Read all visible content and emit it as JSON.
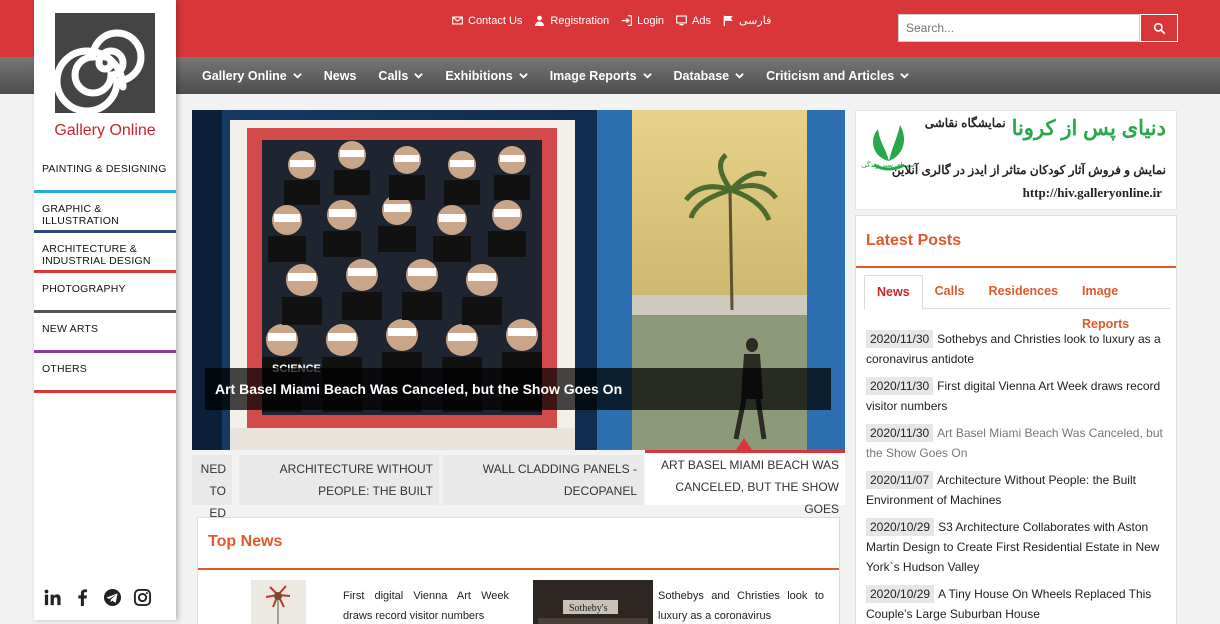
{
  "header": {
    "links": [
      {
        "label": "Contact Us",
        "icon": "envelope-icon"
      },
      {
        "label": "Registration",
        "icon": "user-icon"
      },
      {
        "label": "Login",
        "icon": "sign-in-icon"
      },
      {
        "label": "Ads",
        "icon": "monitor-icon"
      },
      {
        "label": "فارسی",
        "icon": "flag-icon"
      }
    ],
    "search_placeholder": "Search..."
  },
  "nav": {
    "items": [
      {
        "label": "Gallery Online",
        "dropdown": true
      },
      {
        "label": "News",
        "dropdown": false
      },
      {
        "label": "Calls",
        "dropdown": true
      },
      {
        "label": "Exhibitions",
        "dropdown": true
      },
      {
        "label": "Image Reports",
        "dropdown": true
      },
      {
        "label": "Database",
        "dropdown": true
      },
      {
        "label": "Criticism and Articles",
        "dropdown": true
      }
    ]
  },
  "sidebar": {
    "logo_text": "Gallery Online",
    "categories": [
      {
        "label": "PAINTING & DESIGNING",
        "color": "#2aa8d8"
      },
      {
        "label": "GRAPHIC & ILLUSTRATION",
        "color": "#2d4a7a"
      },
      {
        "label": "ARCHITECTURE & INDUSTRIAL DESIGN",
        "color": "#d9363a"
      },
      {
        "label": "PHOTOGRAPHY",
        "color": "#555555"
      },
      {
        "label": "NEW ARTS",
        "color": "#8a3a9a"
      },
      {
        "label": "OTHERS",
        "color": "#d9363a"
      }
    ],
    "socials": [
      "linkedin-icon",
      "facebook-icon",
      "telegram-icon",
      "instagram-icon"
    ]
  },
  "slider": {
    "caption": "Art Basel Miami Beach Was Canceled, but the Show Goes On",
    "thumbs": [
      {
        "line1": "NED TO",
        "line2": "ED FOR"
      },
      {
        "line1": "ARCHITECTURE WITHOUT",
        "line2": "PEOPLE: THE BUILT"
      },
      {
        "line1": "WALL CLADDING PANELS -",
        "line2": "DECOPANEL"
      },
      {
        "line1": "ART BASEL MIAMI BEACH WAS",
        "line2": "CANCELED, BUT THE SHOW GOES"
      }
    ],
    "poster_label": "SCIENCE"
  },
  "top_news": {
    "title": "Top News",
    "items": [
      {
        "text": "First digital Vienna Art Week draws record visitor numbers"
      },
      {
        "text": "Sothebys and Christies look to luxury as a coronavirus"
      }
    ],
    "store_sign": "Sotheby's"
  },
  "ad": {
    "title": "دنیای پس از کرونا",
    "subtitle": "نمایشگاه نقاشی",
    "desc": "نمایش و فروش آثار کودکان متاثر از ایدز در گالری آنلاین",
    "url": "http://hiv.galleryonline.ir",
    "logo_caption": "سیمای سبز زندگی"
  },
  "latest": {
    "title": "Latest Posts",
    "tabs": [
      "News",
      "Calls",
      "Residences",
      "Image Reports"
    ],
    "posts": [
      {
        "date": "2020/11/30",
        "text": "Sothebys and Christies look to luxury as a coronavirus antidote",
        "muted": false
      },
      {
        "date": "2020/11/30",
        "text": "First digital Vienna Art Week draws record visitor numbers",
        "muted": false
      },
      {
        "date": "2020/11/30",
        "text": "Art Basel Miami Beach Was Canceled, but the Show Goes On",
        "muted": true
      },
      {
        "date": "2020/11/07",
        "text": "Architecture Without People: the Built Environment of Machines",
        "muted": false
      },
      {
        "date": "2020/10/29",
        "text": "S3 Architecture Collaborates with Aston Martin Design to Create First Residential Estate in New York`s Hudson Valley",
        "muted": false
      },
      {
        "date": "2020/10/29",
        "text": "A Tiny House On Wheels Replaced This Couple’s Large Suburban House",
        "muted": false
      }
    ]
  }
}
